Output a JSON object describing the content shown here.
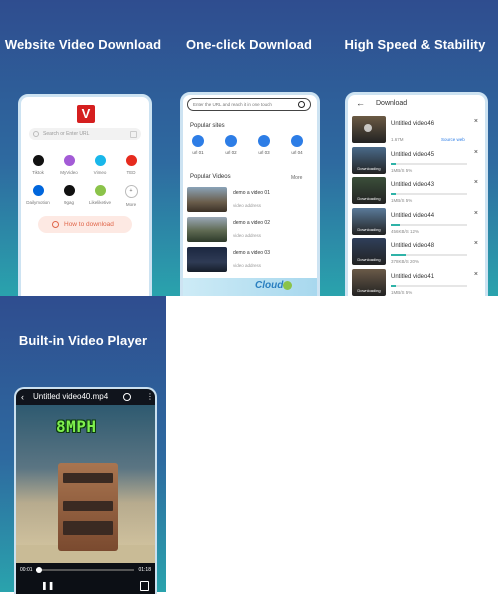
{
  "panels": {
    "p1": {
      "title": "Website Video Download",
      "logo": "V",
      "search_placeholder": "Search or Enter URL",
      "sites": [
        {
          "label": "Tiktok",
          "icon": "tiktok-icon",
          "color": "#111111"
        },
        {
          "label": "MyVideo",
          "icon": "myvideo-icon",
          "color": "#a35bd6"
        },
        {
          "label": "Vimeo",
          "icon": "vimeo-icon",
          "color": "#19b7ea"
        },
        {
          "label": "TED",
          "icon": "ted-icon",
          "color": "#e62b1e"
        },
        {
          "label": "Dailymotion",
          "icon": "dailymotion-icon",
          "color": "#0066dc"
        },
        {
          "label": "9gag",
          "icon": "9gag-icon",
          "color": "#111111"
        },
        {
          "label": "Likeliketive",
          "icon": "likeliketive-icon",
          "color": "#8bc34a"
        },
        {
          "label": "More",
          "icon": "plus-icon",
          "color": "#ffffff"
        }
      ],
      "howto": "How to download"
    },
    "p2": {
      "title": "One-click Download",
      "url_placeholder": "Enter the URL and reach it in one touch",
      "popular_sites_title": "Popular sites",
      "sites": [
        "url 01",
        "url 02",
        "url 03",
        "url 04"
      ],
      "popular_videos_title": "Popular Videos",
      "more": "More",
      "videos": [
        {
          "name": "demo a video 01",
          "address": "video address"
        },
        {
          "name": "demo a video 02",
          "address": "video address"
        },
        {
          "name": "demo a video 03",
          "address": "video address"
        }
      ],
      "banner_text": "Cloud"
    },
    "p3": {
      "title": "High Speed & Stability",
      "header": "Download",
      "items": [
        {
          "name": "Untitled video46",
          "meta": "1.67M",
          "link": "Source web",
          "progress": 1.0,
          "state": ""
        },
        {
          "name": "Untitled video45",
          "meta": "1MB/S  5%",
          "link": "",
          "progress": 0.05,
          "state": "Downloading"
        },
        {
          "name": "Untitled video43",
          "meta": "1MB/S  5%",
          "link": "",
          "progress": 0.05,
          "state": "Downloading"
        },
        {
          "name": "Untitled video44",
          "meta": "456KB/S  12%",
          "link": "",
          "progress": 0.12,
          "state": "Downloading"
        },
        {
          "name": "Untitled video48",
          "meta": "378KB/S  20%",
          "link": "",
          "progress": 0.2,
          "state": "Downloading"
        },
        {
          "name": "Untitled video41",
          "meta": "1MB/S  5%",
          "link": "",
          "progress": 0.05,
          "state": "Downloading"
        }
      ]
    },
    "p4": {
      "title": "Built-in Video Player",
      "video_title": "Untitled video40.mp4",
      "overlay_text": "8MPH",
      "time_current": "00:01",
      "time_total": "01:18",
      "progress": 0.03
    }
  }
}
